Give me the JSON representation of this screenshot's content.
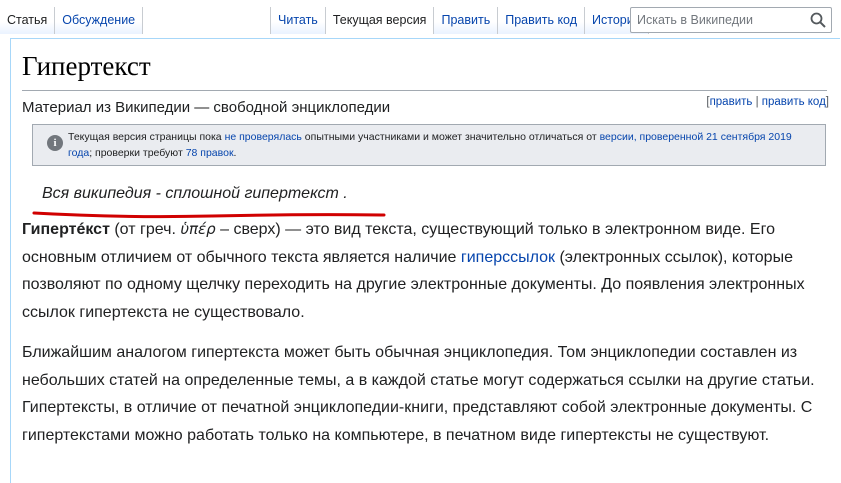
{
  "tabs": {
    "left": [
      "Статья",
      "Обсуждение"
    ],
    "right": [
      "Читать",
      "Текущая версия",
      "Править",
      "Править код",
      "История"
    ]
  },
  "search": {
    "placeholder": "Искать в Википедии"
  },
  "page": {
    "title": "Гипертекст",
    "from_wiki": "Материал из Википедии — свободной энциклопедии",
    "edit_open": "[",
    "edit_link": "править",
    "edit_sep": " | ",
    "edit_code_link": "править код",
    "edit_close": "]"
  },
  "notice": {
    "t1": "Текущая версия страницы пока ",
    "l1": "не проверялась",
    "t2": " опытными участниками и может значительно отличаться от ",
    "l2": "версии, проверенной 21 сентября 2019 года",
    "t3": "; проверки требуют ",
    "l3": "78 правок",
    "t4": "."
  },
  "quote": {
    "text": "Вся википедия - сплошной гипертекст",
    "tail": " ."
  },
  "p1": {
    "term": "Гипертéкст",
    "t1": " (от греч. ",
    "greek": "ὑπέρ",
    "t2": " – сверх) — это вид текста, существующий только в электронном виде. Его основным отличием от обычного текста является наличие ",
    "link": "гиперссылок",
    "t3": " (электронных ссылок), которые позволяют по одному щелчку переходить на другие электронные документы. До появления электронных ссылок гипертекста не существовало."
  },
  "p2": {
    "text": "Ближайшим аналогом гипертекста может быть обычная энциклопедия. Том энциклопедии составлен из небольших статей на определенные темы, а в каждой статье могут содержаться ссылки на другие статьи. Гипертексты, в отличие от печатной энциклопедии-книги, представляют собой электронные документы. С гипертекстами можно работать только на компьютере, в печатном виде гипертексты не существуют."
  },
  "colors": {
    "link": "#0645ad",
    "underline_mark": "#d00000",
    "notice_bg": "#eaecf0"
  },
  "icons": {
    "search": "magnifier-icon",
    "notice": "info-icon"
  }
}
